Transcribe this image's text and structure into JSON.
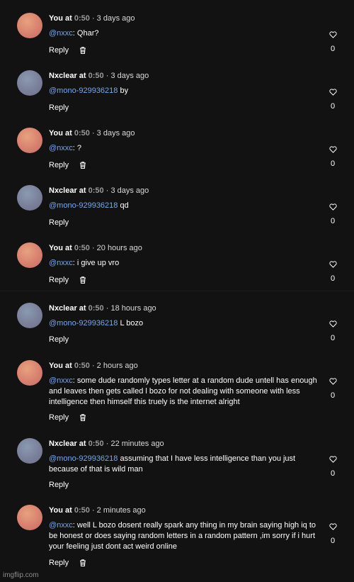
{
  "comments": [
    {
      "user": "You at",
      "ts": "0:50",
      "ago": " · 3 days ago",
      "mention": "@nxxc",
      "text": ": Qhar?",
      "reply": "Reply",
      "likes": "0",
      "avatar": "you",
      "trash": true
    },
    {
      "user": "Nxclear at",
      "ts": "0:50",
      "ago": " · 3 days ago",
      "mention": "@mono-929936218",
      "text": " by",
      "reply": "Reply",
      "likes": "0",
      "avatar": "nx",
      "trash": false
    },
    {
      "user": "You at",
      "ts": "0:50",
      "ago": " · 3 days ago",
      "mention": "@nxxc",
      "text": ": ?",
      "reply": "Reply",
      "likes": "0",
      "avatar": "you",
      "trash": true
    },
    {
      "user": "Nxclear at",
      "ts": "0:50",
      "ago": " · 3 days ago",
      "mention": "@mono-929936218",
      "text": " qd",
      "reply": "Reply",
      "likes": "0",
      "avatar": "nx",
      "trash": false
    },
    {
      "user": "You at",
      "ts": "0:50",
      "ago": " · 20 hours ago",
      "mention": "@nxxc",
      "text": ": i give up vro",
      "reply": "Reply",
      "likes": "0",
      "avatar": "you",
      "trash": true
    },
    {
      "user": "Nxclear at",
      "ts": "0:50",
      "ago": " · 18 hours ago",
      "mention": "@mono-929936218",
      "text": " L bozo",
      "reply": "Reply",
      "likes": "0",
      "avatar": "nx",
      "trash": false
    },
    {
      "user": "You at",
      "ts": "0:50",
      "ago": " · 2 hours ago",
      "mention": "@nxxc",
      "text": ": some dude randomly types letter at a random dude untell has enough and leaves then gets called l bozo for not dealing with someone with less intelligence then himself this truely is the internet alright",
      "reply": "Reply",
      "likes": "0",
      "avatar": "you",
      "trash": true
    },
    {
      "user": "Nxclear at",
      "ts": "0:50",
      "ago": " · 22 minutes ago",
      "mention": "@mono-929936218",
      "text": " assuming that I have less intelligence than you just because of that is wild man",
      "reply": "Reply",
      "likes": "0",
      "avatar": "nx",
      "trash": false
    },
    {
      "user": "You at",
      "ts": "0:50",
      "ago": " · 2 minutes ago",
      "mention": "@nxxc",
      "text": ": well L bozo dosent really spark any thing in my brain saying high iq to be honest or does saying random letters in a random pattern ,im sorry if i hurt your feeling just dont act weird online",
      "reply": "Reply",
      "likes": "0",
      "avatar": "you",
      "trash": true
    }
  ],
  "watermark": "imgflip.com",
  "colors": {
    "background": "#121212",
    "mention": "#7aa7e8",
    "timestamp": "#9a9a9a"
  },
  "icons": {
    "like": "heart-outline-icon",
    "delete": "trash-icon"
  }
}
